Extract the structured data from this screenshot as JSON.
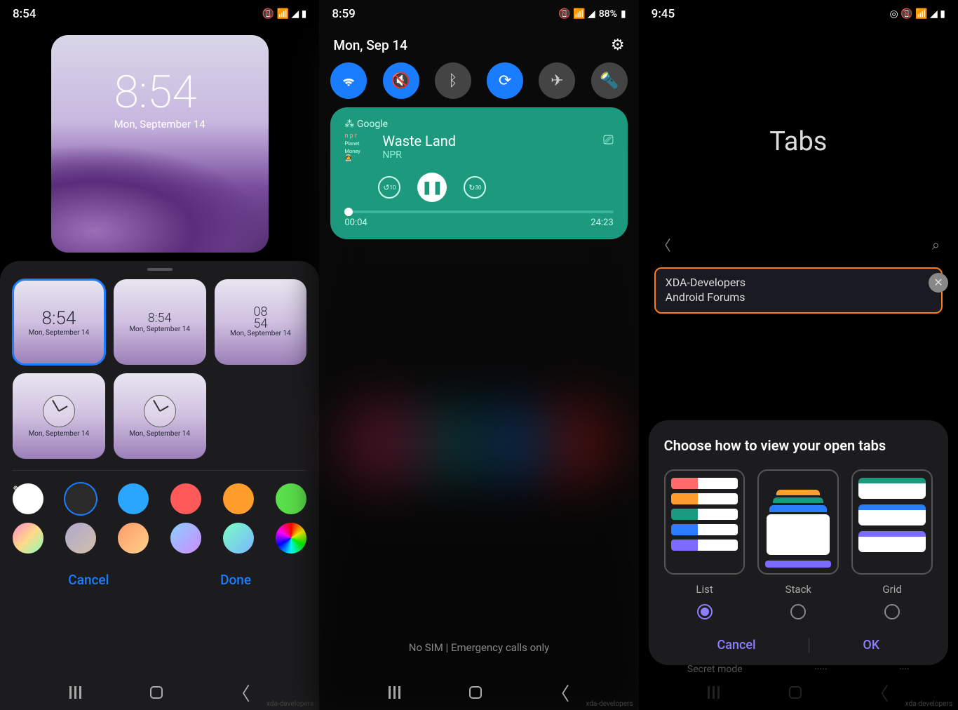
{
  "phone1": {
    "status": {
      "time": "8:54"
    },
    "preview": {
      "time": "8:54",
      "date": "Mon, September 14"
    },
    "styles": [
      {
        "time": "8:54",
        "date": "Mon, September 14",
        "selected": true
      },
      {
        "time": "8:54",
        "date": "Mon, September 14"
      },
      {
        "time": "08 54",
        "date": "Mon, September 14"
      },
      {
        "type": "analog",
        "date": "Mon, September 14"
      },
      {
        "type": "analog",
        "date": "Mon, September 14"
      }
    ],
    "colors_row1": [
      "#ffffff",
      "#2a2a2a",
      "#2aa6ff",
      "#ff5a5a",
      "#ff9e2a",
      "#5ae04a"
    ],
    "colors_row2": [
      "gradient1",
      "gradient2",
      "gradient3",
      "gradient4",
      "gradient5",
      "rainbow"
    ],
    "actions": {
      "cancel": "Cancel",
      "done": "Done"
    }
  },
  "phone2": {
    "status": {
      "time": "8:59",
      "battery": "88%"
    },
    "date": "Mon, Sep 14",
    "qs": [
      "wifi",
      "mute",
      "bluetooth",
      "rotate",
      "airplane",
      "flashlight"
    ],
    "media": {
      "source": "Google",
      "art_line1": "Planet Money",
      "title": "Waste Land",
      "subtitle": "NPR",
      "rewind": "10",
      "forward": "30",
      "current": "00:04",
      "total": "24:23"
    },
    "footer": "No SIM | Emergency calls only"
  },
  "phone3": {
    "status": {
      "time": "9:45"
    },
    "header": "Tabs",
    "tab_preview": {
      "line1": "XDA-Developers",
      "line2": "Android Forums"
    },
    "modal": {
      "title": "Choose how to view your open tabs",
      "options": [
        {
          "label": "List",
          "selected": true
        },
        {
          "label": "Stack"
        },
        {
          "label": "Grid"
        }
      ],
      "cancel": "Cancel",
      "ok": "OK"
    },
    "bottom": {
      "secret": "Secret mode"
    }
  },
  "watermark": "xda-developers"
}
